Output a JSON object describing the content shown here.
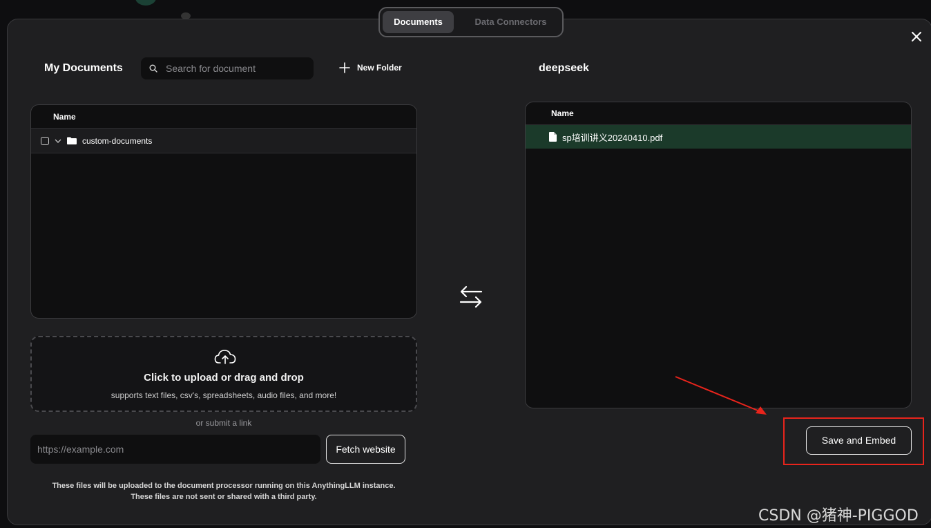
{
  "tabs": [
    {
      "label": "Documents",
      "active": true
    },
    {
      "label": "Data Connectors",
      "active": false
    }
  ],
  "left": {
    "title": "My Documents",
    "search_placeholder": "Search for document",
    "new_folder_label": "New Folder",
    "table_header": "Name",
    "rows": [
      {
        "name": "custom-documents",
        "type": "folder"
      }
    ]
  },
  "right": {
    "title": "deepseek",
    "table_header": "Name",
    "rows": [
      {
        "name": "sp培训讲义20240410.pdf",
        "type": "file"
      }
    ]
  },
  "upload": {
    "title": "Click to upload or drag and drop",
    "subtitle": "supports text files, csv's, spreadsheets, audio files, and more!",
    "or_link": "or submit a link",
    "url_placeholder": "https://example.com",
    "fetch_label": "Fetch website",
    "note_line1": "These files will be uploaded to the document processor running on this AnythingLLM instance.",
    "note_line2": "These files are not sent or shared with a third party."
  },
  "save_label": "Save and Embed",
  "watermark": "CSDN @猪神-PIGGOD",
  "colors": {
    "accent_highlight": "#e8241c",
    "selected_row": "#1b3a2a"
  }
}
